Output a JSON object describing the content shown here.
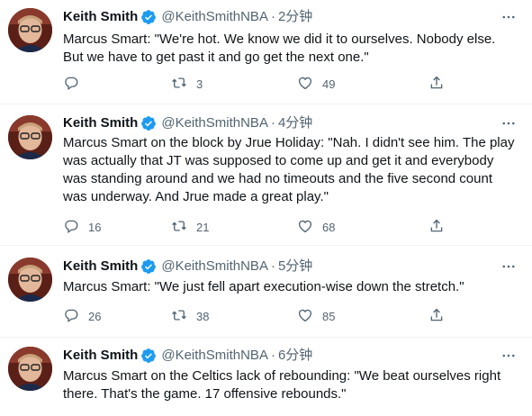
{
  "tweets": [
    {
      "name": "Keith Smith",
      "handle": "@KeithSmithNBA",
      "separator": "·",
      "time": "2分钟",
      "text": "Marcus Smart: \"We're hot. We know we did it to ourselves. Nobody else. But we have to get past it and go get the next one.\"",
      "replies": "",
      "retweets": "3",
      "likes": "49"
    },
    {
      "name": "Keith Smith",
      "handle": "@KeithSmithNBA",
      "separator": "·",
      "time": "4分钟",
      "text": "Marcus Smart on the block by Jrue Holiday: \"Nah. I didn't see him. The play was actually that JT was supposed to come up and get it and everybody was standing around and we had no timeouts and the five second count was underway. And Jrue made a great play.\"",
      "replies": "16",
      "retweets": "21",
      "likes": "68"
    },
    {
      "name": "Keith Smith",
      "handle": "@KeithSmithNBA",
      "separator": "·",
      "time": "5分钟",
      "text": "Marcus Smart: \"We just fell apart execution-wise down the stretch.\"",
      "replies": "26",
      "retweets": "38",
      "likes": "85"
    },
    {
      "name": "Keith Smith",
      "handle": "@KeithSmithNBA",
      "separator": "·",
      "time": "6分钟",
      "text": "Marcus Smart on the Celtics lack of rebounding: \"We beat ourselves right there. That's the game. 17 offensive rebounds.\"",
      "replies": "",
      "retweets": "",
      "likes": ""
    }
  ],
  "icons": {
    "verified": "verified-badge-icon",
    "more": "more-options-icon",
    "reply": "reply-icon",
    "retweet": "retweet-icon",
    "like": "like-heart-icon",
    "share": "share-icon"
  },
  "colors": {
    "name": "#0f1419",
    "secondary": "#536471",
    "verified": "#1d9bf0",
    "divider": "#eff3f4"
  }
}
